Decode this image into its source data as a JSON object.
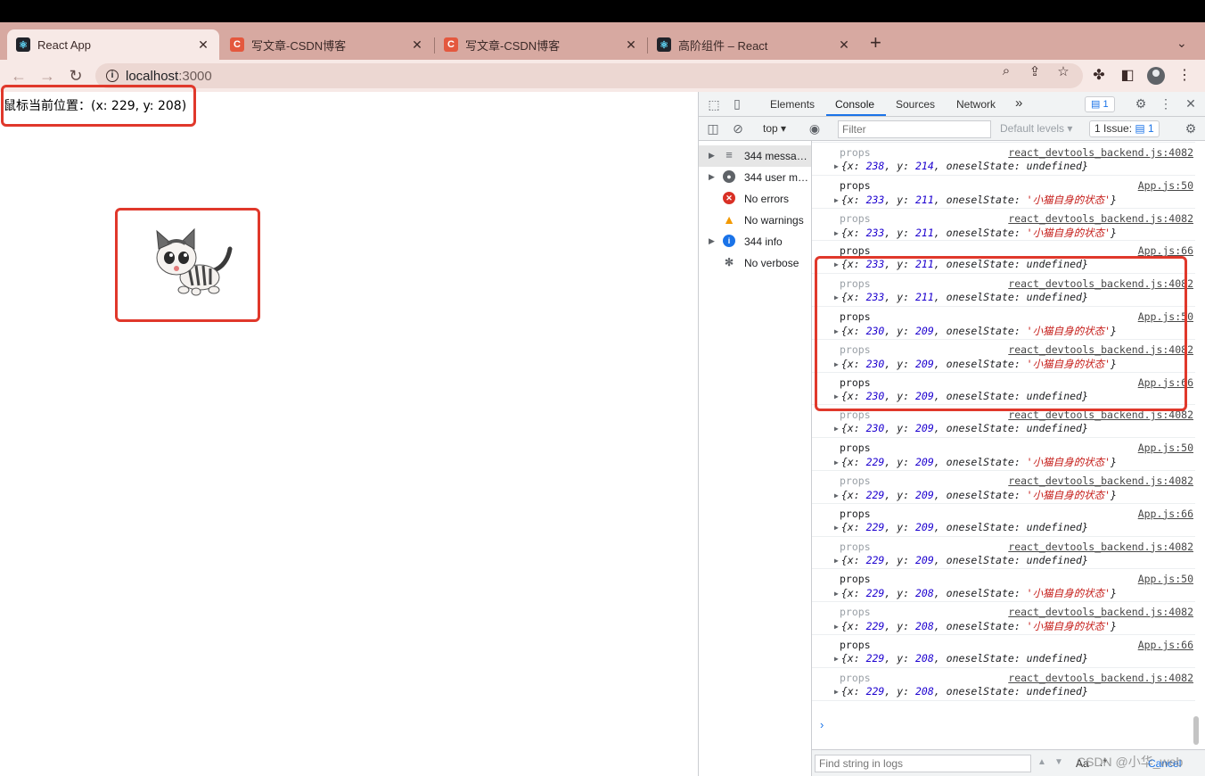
{
  "browser": {
    "tabs": [
      {
        "title": "React App",
        "icon": "react-icon",
        "active": true
      },
      {
        "title": "写文章-CSDN博客",
        "icon": "csdn-icon",
        "active": false
      },
      {
        "title": "写文章-CSDN博客",
        "icon": "csdn-icon",
        "active": false
      },
      {
        "title": "高阶组件 – React",
        "icon": "react-icon",
        "active": false
      }
    ],
    "close_glyph": "✕",
    "new_tab_glyph": "+",
    "url_host": "localhost",
    "url_port": ":3000",
    "tab_strip_color": "#d7a9a1",
    "toolbar_color": "#f7e9e6"
  },
  "page": {
    "mouse_position_text": "鼠标当前位置：(x: 229, y: 208)",
    "annotation_color": "#e0382b"
  },
  "devtools": {
    "tabs": [
      "Elements",
      "Console",
      "Sources",
      "Network"
    ],
    "active_tab": "Console",
    "more_tabs": "»",
    "message_badge": "1",
    "context": "top",
    "filter_placeholder": "Filter",
    "levels_label": "Default levels",
    "issues_label": "1 Issue:",
    "issues_count": "1",
    "sidebar": [
      {
        "label": "344 messa…",
        "icon": "list-icon",
        "expandable": true,
        "selected": true
      },
      {
        "label": "344 user m…",
        "icon": "user-icon",
        "expandable": true,
        "selected": false
      },
      {
        "label": "No errors",
        "icon": "error-icon",
        "expandable": false,
        "selected": false
      },
      {
        "label": "No warnings",
        "icon": "warning-icon",
        "expandable": false,
        "selected": false
      },
      {
        "label": "344 info",
        "icon": "info-icon",
        "expandable": true,
        "selected": false
      },
      {
        "label": "No verbose",
        "icon": "bug-icon",
        "expandable": false,
        "selected": false
      }
    ],
    "first_line": {
      "x": "238",
      "y": "214",
      "state": "undefined"
    },
    "logs": [
      {
        "label": "props",
        "source": "react_devtools_backend.js:4082",
        "x": "238",
        "y": "214",
        "state": "undefined",
        "grey": true
      },
      {
        "label": "props",
        "source": "App.js:50",
        "x": "233",
        "y": "211",
        "state": "'小猫自身的状态'",
        "grey": false
      },
      {
        "label": "props",
        "source": "react_devtools_backend.js:4082",
        "x": "233",
        "y": "211",
        "state": "'小猫自身的状态'",
        "grey": true
      },
      {
        "label": "props",
        "source": "App.js:66",
        "x": "233",
        "y": "211",
        "state": "undefined",
        "grey": false
      },
      {
        "label": "props",
        "source": "react_devtools_backend.js:4082",
        "x": "233",
        "y": "211",
        "state": "undefined",
        "grey": true
      },
      {
        "label": "props",
        "source": "App.js:50",
        "x": "230",
        "y": "209",
        "state": "'小猫自身的状态'",
        "grey": false
      },
      {
        "label": "props",
        "source": "react_devtools_backend.js:4082",
        "x": "230",
        "y": "209",
        "state": "'小猫自身的状态'",
        "grey": true
      },
      {
        "label": "props",
        "source": "App.js:66",
        "x": "230",
        "y": "209",
        "state": "undefined",
        "grey": false
      },
      {
        "label": "props",
        "source": "react_devtools_backend.js:4082",
        "x": "230",
        "y": "209",
        "state": "undefined",
        "grey": true
      },
      {
        "label": "props",
        "source": "App.js:50",
        "x": "229",
        "y": "209",
        "state": "'小猫自身的状态'",
        "grey": false
      },
      {
        "label": "props",
        "source": "react_devtools_backend.js:4082",
        "x": "229",
        "y": "209",
        "state": "'小猫自身的状态'",
        "grey": true
      },
      {
        "label": "props",
        "source": "App.js:66",
        "x": "229",
        "y": "209",
        "state": "undefined",
        "grey": false
      },
      {
        "label": "props",
        "source": "react_devtools_backend.js:4082",
        "x": "229",
        "y": "209",
        "state": "undefined",
        "grey": true
      },
      {
        "label": "props",
        "source": "App.js:50",
        "x": "229",
        "y": "208",
        "state": "'小猫自身的状态'",
        "grey": false
      },
      {
        "label": "props",
        "source": "react_devtools_backend.js:4082",
        "x": "229",
        "y": "208",
        "state": "'小猫自身的状态'",
        "grey": true
      },
      {
        "label": "props",
        "source": "App.js:66",
        "x": "229",
        "y": "208",
        "state": "undefined",
        "grey": false
      },
      {
        "label": "props",
        "source": "react_devtools_backend.js:4082",
        "x": "229",
        "y": "208",
        "state": "undefined",
        "grey": true
      }
    ],
    "obj_key_x": "x",
    "obj_key_y": "y",
    "obj_key_state": "oneselState",
    "prompt_glyph": "›",
    "find_placeholder": "Find string in logs",
    "find_aa": "Aa",
    "find_regex": ".*",
    "find_cancel": "Cancel"
  },
  "watermark": "CSDN @小华_web"
}
